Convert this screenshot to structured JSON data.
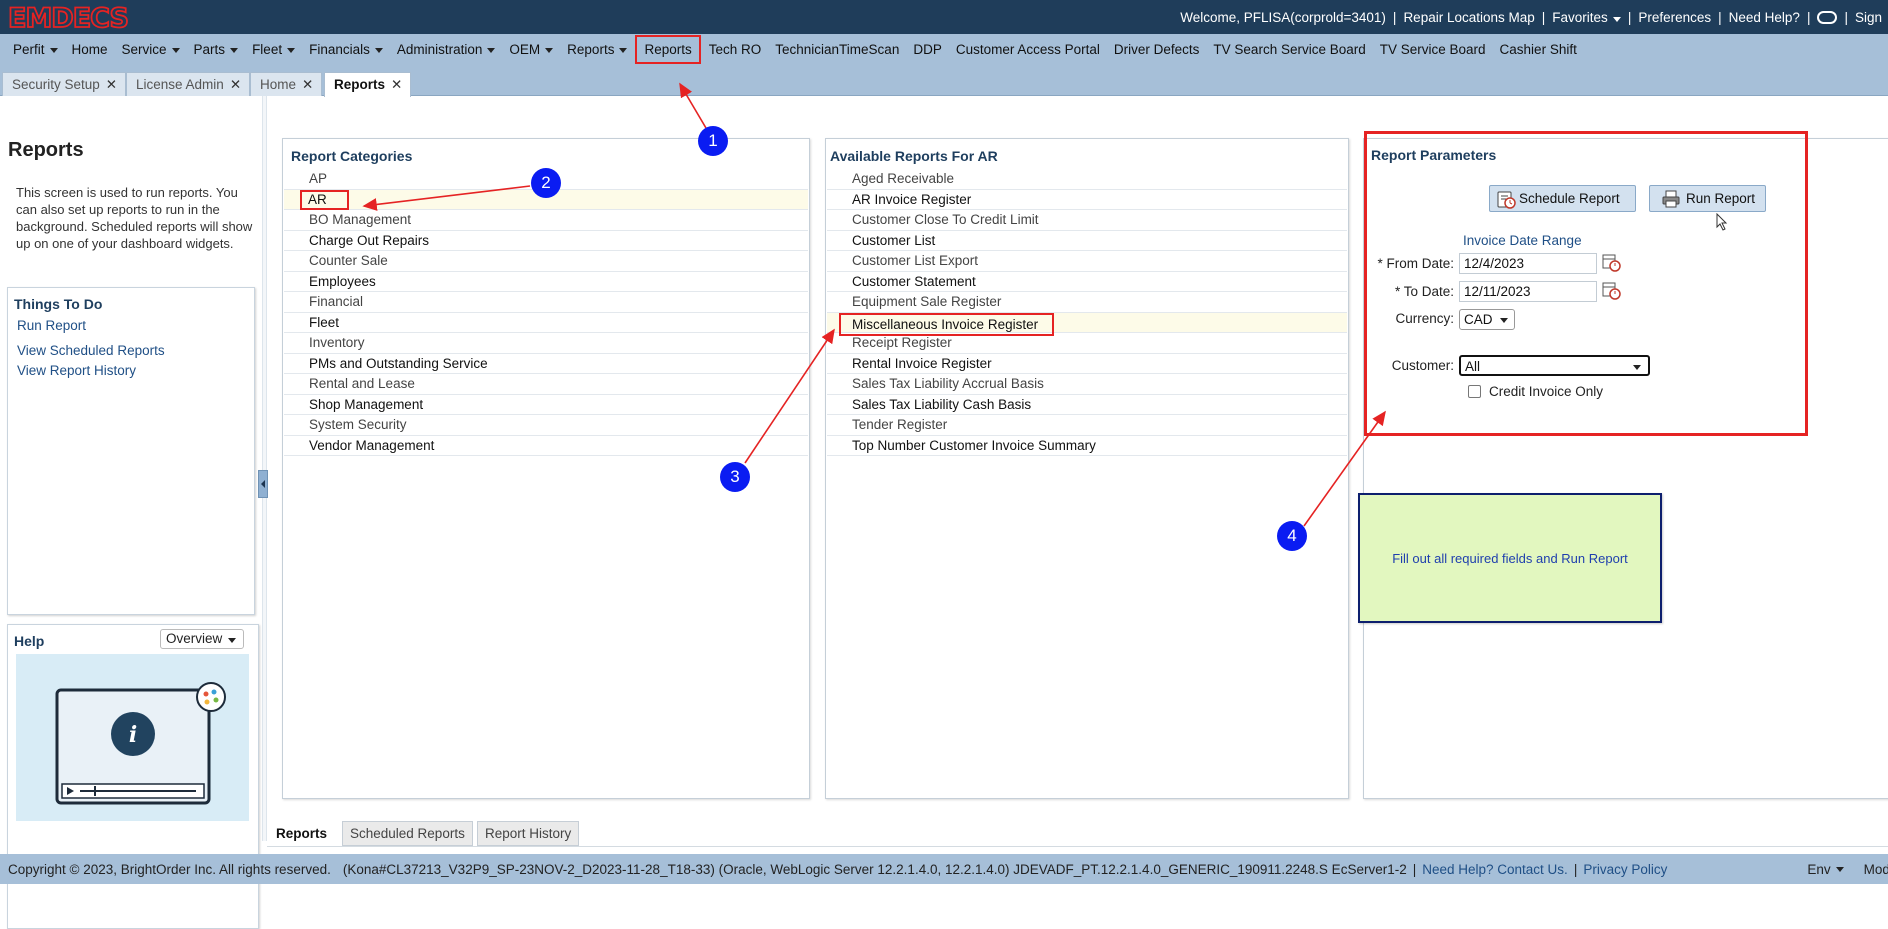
{
  "app": {
    "logo": "EMDECS"
  },
  "topbar": {
    "welcome": "Welcome, PFLISA(corprold=3401)",
    "links": [
      "Repair Locations Map",
      "Favorites",
      "Preferences",
      "Need Help?",
      "Sign"
    ]
  },
  "nav": {
    "items": [
      "Perfit",
      "Home",
      "Service",
      "Parts",
      "Fleet",
      "Financials",
      "Administration",
      "OEM",
      "Reports",
      "Reports",
      "Tech RO",
      "TechnicianTimeScan",
      "DDP",
      "Customer Access Portal",
      "Driver Defects",
      "TV Search Service Board",
      "TV Service Board",
      "Cashier Shift"
    ]
  },
  "page_tabs": [
    "Security Setup",
    "License Admin",
    "Home",
    "Reports"
  ],
  "left": {
    "title": "Reports",
    "description": "This screen is used to run reports. You can also set up reports to run in the background. Scheduled reports will show up on one of your dashboard widgets.",
    "todo_title": "Things To Do",
    "todo_links": [
      "Run Report",
      "View Scheduled Reports",
      "View Report History"
    ],
    "help_title": "Help",
    "help_select": "Overview"
  },
  "categories": {
    "title": "Report Categories",
    "items": [
      "AP",
      "AR",
      "BO Management",
      "Charge Out Repairs",
      "Counter Sale",
      "Employees",
      "Financial",
      "Fleet",
      "Inventory",
      "PMs and Outstanding Service",
      "Rental and Lease",
      "Shop Management",
      "System Security",
      "Vendor Management"
    ]
  },
  "available": {
    "title": "Available Reports For AR",
    "items": [
      "Aged Receivable",
      "AR Invoice Register",
      "Customer Close To Credit Limit",
      "Customer List",
      "Customer List Export",
      "Customer Statement",
      "Equipment Sale Register",
      "Miscellaneous Invoice Register",
      "Receipt Register",
      "Rental Invoice Register",
      "Sales Tax Liability Accrual Basis",
      "Sales Tax Liability Cash Basis",
      "Tender Register",
      "Top Number Customer Invoice Summary"
    ]
  },
  "params": {
    "title": "Report Parameters",
    "schedule_button": "Schedule Report",
    "run_button": "Run Report",
    "date_range_label": "Invoice Date Range",
    "from_label": "* From Date:",
    "from_value": "12/4/2023",
    "to_label": "* To Date:",
    "to_value": "12/11/2023",
    "currency_label": "Currency:",
    "currency_value": "CAD",
    "customer_label": "Customer:",
    "customer_value": "All",
    "credit_only_label": "Credit Invoice Only"
  },
  "note": {
    "text": "Fill out all required fields and Run Report"
  },
  "markers": [
    "1",
    "2",
    "3",
    "4"
  ],
  "bottom_tabs": [
    "Reports",
    "Scheduled Reports",
    "Report History"
  ],
  "footer": {
    "copyright": "Copyright © 2023, BrightOrder Inc. All rights reserved.",
    "build": "(Kona#CL37213_V32P9_SP-23NOV-2_D2023-11-28_T18-33) (Oracle, WebLogic Server 12.2.1.4.0, 12.2.1.4.0) JDEVADF_PT.12.2.1.4.0_GENERIC_190911.2248.S EcServer1-2",
    "help_link": "Need Help? Contact Us.",
    "privacy_link": "Privacy Policy",
    "env": "Env",
    "mode": "Mode"
  },
  "colors": {
    "topbar": "#1f3d5a",
    "nav": "#a6bfd8",
    "accent_red": "#e52323",
    "marker_blue": "#0a1cf2",
    "note_bg": "#e2f7bf"
  }
}
